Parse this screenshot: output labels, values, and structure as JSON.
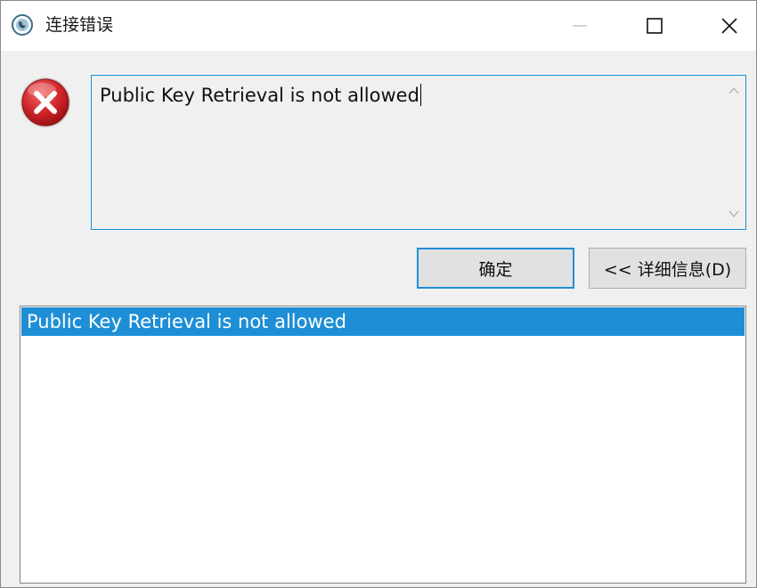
{
  "window": {
    "title": "连接错误",
    "app_icon": "navicat-icon",
    "controls": {
      "minimize_icon": "minimize-icon",
      "maximize_icon": "maximize-icon",
      "close_icon": "close-icon"
    }
  },
  "error": {
    "icon": "error-icon",
    "message": "Public Key Retrieval is not allowed"
  },
  "buttons": {
    "ok_label": "确定",
    "details_label": "<< 详细信息(D)"
  },
  "details": {
    "items": [
      "Public Key Retrieval is not allowed"
    ]
  },
  "colors": {
    "accent": "#1e8fd6",
    "error_red": "#d0252a",
    "selection": "#1e8fd6"
  }
}
